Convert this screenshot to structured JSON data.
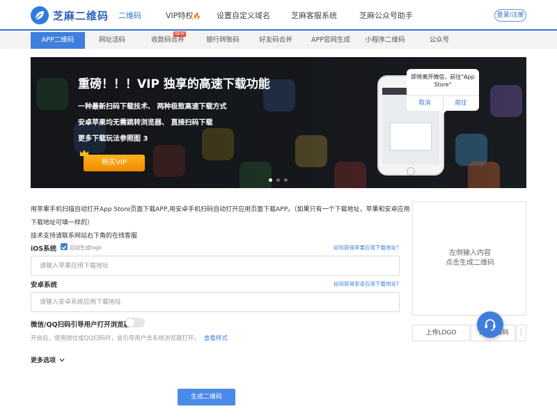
{
  "header": {
    "logo_text": "芝麻二维码",
    "nav": [
      {
        "label": "二维码",
        "active": true
      },
      {
        "label": "VIP特权",
        "badge": "fire-icon"
      },
      {
        "label": "设置自定义域名"
      },
      {
        "label": "芝麻客服系统"
      },
      {
        "label": "芝麻公众号助手"
      }
    ],
    "login_label": "登录/注册"
  },
  "tabs": {
    "items": [
      "APP二维码",
      "网址活码",
      "收款码合并",
      "银行转账码",
      "好友码合并",
      "APP官网生成",
      "小程序二维码",
      "公众号"
    ],
    "active_index": 0,
    "new_badge": "NEW"
  },
  "banner": {
    "title": "重磅！！！VIP 独享的高速下载功能",
    "lines": [
      "一种最新扫码下载技术、 两种极致高速下载方式",
      "安卓苹果均无需跳转浏览器、 直接扫码下载",
      "更多下载玩法参照图 3"
    ],
    "vip_button": "购买VIP",
    "popup_title": "即将离开微信，前往\"App Store\"",
    "popup_cancel": "取消",
    "popup_confirm": "前往",
    "slide_count": 3,
    "active_slide": 1
  },
  "form": {
    "desc_1": "用苹果手机扫描自动打开App Store页面下载APP,用安卓手机扫码自动打开应用页面下载APP。（如果只有一个下载地址，苹果和安卓应用",
    "desc_2": "下载地址可填一样的）",
    "desc_3": "技术支持请联系网站右下角的在线客服",
    "ios_label": "iOS系统",
    "auto_logo_label": "自动生成logo",
    "auto_logo_checked": true,
    "ios_help": "如何获得苹果应用下载地址?",
    "ios_placeholder": "请输入苹果应用下载地址",
    "android_label": "安卓系统",
    "android_help": "如何获得安卓应用下载地址?",
    "android_placeholder": "请输入安卓系统应用下载地址",
    "wechat_label": "微信/QQ扫码引导用户打开浏览器",
    "wechat_toggle_on": false,
    "wechat_hint": "开启后，使用微信或QQ扫码时，会引导用户去系统浏览器打开。",
    "wechat_hint_link": "查看样式",
    "more_options": "更多选项",
    "generate_label": "生成二维码"
  },
  "preview": {
    "line_1": "左侧输入内容",
    "line_2": "点击生成二维码",
    "upload_logo": "上传LOGO",
    "download_label": "下载二维码"
  },
  "colors": {
    "brand": "#2d73d6",
    "tab_active": "#3f7edc",
    "vip_orange": "#f5a00d"
  }
}
